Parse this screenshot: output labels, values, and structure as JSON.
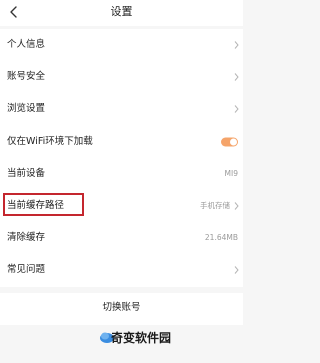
{
  "header": {
    "title": "设置",
    "back_icon": "chevron-left-icon"
  },
  "settings": {
    "personal_info": "个人信息",
    "account_security": "账号安全",
    "browse_settings": "浏览设置",
    "wifi_only_label": "仅在WiFi环境下加载",
    "wifi_only_enabled": true,
    "current_device_label": "当前设备",
    "current_device_value": "MI9",
    "cache_path_label": "当前缓存路径",
    "cache_path_value": "手机存储",
    "clear_cache_label": "清除缓存",
    "clear_cache_value": "21.64MB",
    "faq_label": "常见问题"
  },
  "switch_account": {
    "label": "切换账号"
  },
  "watermark": {
    "text": "奇变软件园",
    "icon": "cloud-icon"
  },
  "colors": {
    "toggle_on": "#f5a46a",
    "highlight_border": "#c4262e"
  }
}
